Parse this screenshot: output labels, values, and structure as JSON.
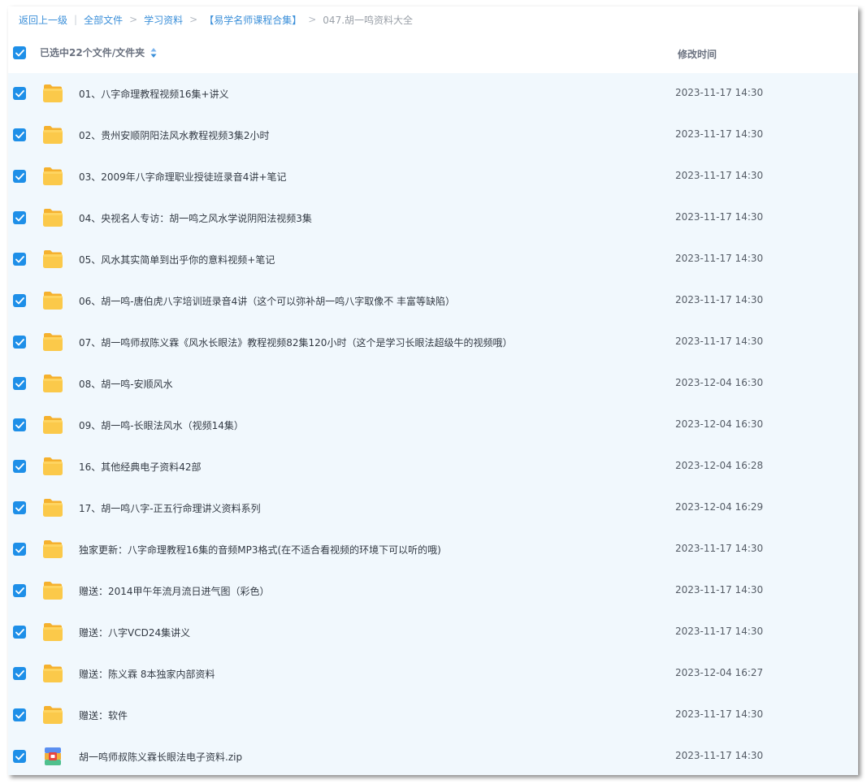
{
  "breadcrumb": {
    "back": "返回上一级",
    "sep_bar": "|",
    "sep_arrow": ">",
    "all_files": "全部文件",
    "study": "学习资料",
    "course": "【易学名师课程合集】",
    "current": "047.胡一鸣资料大全"
  },
  "header": {
    "selected_label": "已选中22个文件/文件夹",
    "time_label": "修改时间"
  },
  "colors": {
    "accent": "#1e8fe8",
    "link": "#3b8fd9",
    "folder": "#fbc94a",
    "list_bg": "#f1f8fd"
  },
  "files": [
    {
      "name": "01、八字命理教程视频16集+讲义",
      "time": "2023-11-17 14:30",
      "icon": "folder-icon"
    },
    {
      "name": "02、贵州安顺阴阳法风水教程视频3集2小时",
      "time": "2023-11-17 14:30",
      "icon": "folder-icon"
    },
    {
      "name": "03、2009年八字命理职业授徒班录音4讲+笔记",
      "time": "2023-11-17 14:30",
      "icon": "folder-icon"
    },
    {
      "name": "04、央视名人专访：胡一鸣之风水学说阴阳法视频3集",
      "time": "2023-11-17 14:30",
      "icon": "folder-icon"
    },
    {
      "name": "05、风水其实简单到出乎你的意料视频+笔记",
      "time": "2023-11-17 14:30",
      "icon": "folder-icon"
    },
    {
      "name": "06、胡一鸣-唐伯虎八字培训班录音4讲（这个可以弥补胡一鸣八字取像不 丰富等缺陷）",
      "time": "2023-11-17 14:30",
      "icon": "folder-icon"
    },
    {
      "name": "07、胡一鸣师叔陈义霖《风水长眼法》教程视频82集120小时（这个是学习长眼法超级牛的视频哦）",
      "time": "2023-11-17 14:30",
      "icon": "folder-icon"
    },
    {
      "name": "08、胡一鸣-安顺风水",
      "time": "2023-12-04 16:30",
      "icon": "folder-icon"
    },
    {
      "name": "09、胡一鸣-长眼法风水（视频14集）",
      "time": "2023-12-04 16:30",
      "icon": "folder-icon"
    },
    {
      "name": "16、其他经典电子资料42部",
      "time": "2023-12-04 16:28",
      "icon": "folder-icon"
    },
    {
      "name": "17、胡一鸣八字-正五行命理讲义资料系列",
      "time": "2023-12-04 16:29",
      "icon": "folder-icon"
    },
    {
      "name": "独家更新：八字命理教程16集的音频MP3格式(在不适合看视频的环境下可以听的哦)",
      "time": "2023-11-17 14:30",
      "icon": "folder-icon"
    },
    {
      "name": "赠送：2014甲午年流月流日进气图（彩色）",
      "time": "2023-11-17 14:30",
      "icon": "folder-icon"
    },
    {
      "name": "赠送：八字VCD24集讲义",
      "time": "2023-11-17 14:30",
      "icon": "folder-icon"
    },
    {
      "name": "赠送：陈义霖 8本独家内部资料",
      "time": "2023-12-04 16:27",
      "icon": "folder-icon"
    },
    {
      "name": "赠送：软件",
      "time": "2023-11-17 14:30",
      "icon": "folder-icon"
    },
    {
      "name": "胡一鸣师叔陈义霖长眼法电子资料.zip",
      "time": "2023-11-17 14:30",
      "icon": "zip-file-icon"
    }
  ]
}
